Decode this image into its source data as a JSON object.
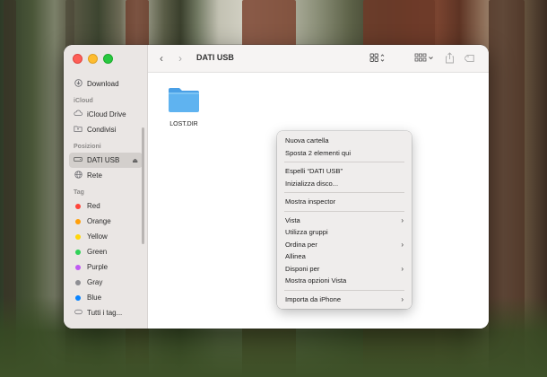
{
  "window": {
    "title": "DATI USB"
  },
  "sidebar": {
    "favorites": [
      {
        "label": "Download",
        "icon": "download-icon"
      }
    ],
    "icloud_header": "iCloud",
    "icloud": [
      {
        "label": "iCloud Drive",
        "icon": "cloud-icon"
      },
      {
        "label": "Condivisi",
        "icon": "shared-folder-icon"
      }
    ],
    "locations_header": "Posizioni",
    "locations": [
      {
        "label": "DATI USB",
        "icon": "drive-icon",
        "selected": true,
        "eject": "⏏"
      },
      {
        "label": "Rete",
        "icon": "network-icon"
      }
    ],
    "tags_header": "Tag",
    "tags": [
      {
        "label": "Red",
        "color": "#ff453a"
      },
      {
        "label": "Orange",
        "color": "#ff9f0a"
      },
      {
        "label": "Yellow",
        "color": "#ffd60a"
      },
      {
        "label": "Green",
        "color": "#30d158"
      },
      {
        "label": "Purple",
        "color": "#bf5af2"
      },
      {
        "label": "Gray",
        "color": "#8e8e93"
      },
      {
        "label": "Blue",
        "color": "#0a84ff"
      }
    ],
    "all_tags": "Tutti i tag..."
  },
  "files": [
    {
      "name": "LOST.DIR",
      "icon": "folder-icon",
      "color": "#5fb3f0"
    }
  ],
  "context_menu": {
    "groups": [
      [
        {
          "label": "Nuova cartella"
        },
        {
          "label": "Sposta 2 elementi qui"
        }
      ],
      [
        {
          "label": "Espelli “DATI USB”"
        },
        {
          "label": "Inizializza disco..."
        }
      ],
      [
        {
          "label": "Mostra inspector"
        }
      ],
      [
        {
          "label": "Vista",
          "submenu": true
        },
        {
          "label": "Utilizza gruppi"
        },
        {
          "label": "Ordina per",
          "submenu": true
        },
        {
          "label": "Allinea"
        },
        {
          "label": "Disponi per",
          "submenu": true
        },
        {
          "label": "Mostra opzioni Vista"
        }
      ],
      [
        {
          "label": "Importa da iPhone",
          "submenu": true
        }
      ]
    ]
  }
}
